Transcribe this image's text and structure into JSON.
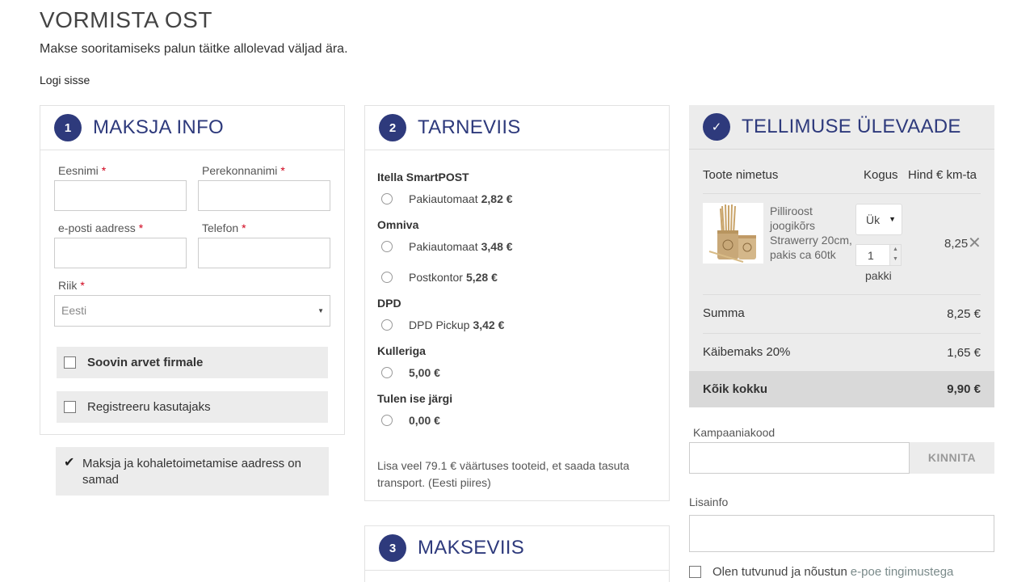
{
  "page": {
    "title": "VORMISTA OST",
    "subtitle": "Makse sooritamiseks palun täitke allolevad väljad ära.",
    "login_link": "Logi sisse"
  },
  "payer": {
    "step": "1",
    "title": "MAKSJA INFO",
    "first_name_label": "Eesnimi",
    "last_name_label": "Perekonnanimi",
    "email_label": "e-posti aadress",
    "phone_label": "Telefon",
    "country_label": "Riik",
    "required_mark": "*",
    "country_value": "Eesti",
    "invoice_company_label": "Soovin arvet firmale",
    "register_label": "Registreeru kasutajaks",
    "same_address_label": "Maksja ja kohaletoimetamise aadress on samad"
  },
  "shipping": {
    "step": "2",
    "title": "TARNEVIIS",
    "carriers": [
      {
        "name": "Itella SmartPOST",
        "options": [
          {
            "label": "Pakiautomaat",
            "price": "2,82 €"
          }
        ]
      },
      {
        "name": "Omniva",
        "options": [
          {
            "label": "Pakiautomaat",
            "price": "3,48 €"
          },
          {
            "label": "Postkontor",
            "price": "5,28 €"
          }
        ]
      },
      {
        "name": "DPD",
        "options": [
          {
            "label": "DPD Pickup",
            "price": "3,42 €"
          }
        ]
      },
      {
        "name": "Kulleriga",
        "options": [
          {
            "label": "",
            "price": "5,00 €"
          }
        ]
      },
      {
        "name": "Tulen ise järgi",
        "options": [
          {
            "label": "",
            "price": "0,00 €"
          }
        ]
      }
    ],
    "note": "Lisa veel 79.1 € väärtuses tooteid, et saada tasuta transport. (Eesti piires)"
  },
  "payment": {
    "step": "3",
    "title": "MAKSEVIIS"
  },
  "overview": {
    "check": "✓",
    "title": "TELLIMUSE ÜLEVAADE",
    "col_product": "Toote nimetus",
    "col_qty": "Kogus",
    "col_price": "Hind € km-ta",
    "item": {
      "name": "Pilliroost joogikõrs Strawerry 20cm, pakis ca 60tk",
      "unit": "Ük",
      "qty": "1",
      "qty_unit": "pakki",
      "price": "8,25"
    },
    "sum_label": "Summa",
    "sum_value": "8,25 €",
    "vat_label": "Käibemaks 20%",
    "vat_value": "1,65 €",
    "total_label": "Kõik kokku",
    "total_value": "9,90 €"
  },
  "promo": {
    "label": "Kampaaniakood",
    "button": "KINNITA"
  },
  "extra": {
    "label": "Lisainfo"
  },
  "terms": {
    "text": "Olen tutvunud ja nõustun",
    "link": "e-poe tingimustega"
  },
  "colors": {
    "accent": "#2e3a7c",
    "panel_grey": "#ececec",
    "required": "#d0021b"
  }
}
